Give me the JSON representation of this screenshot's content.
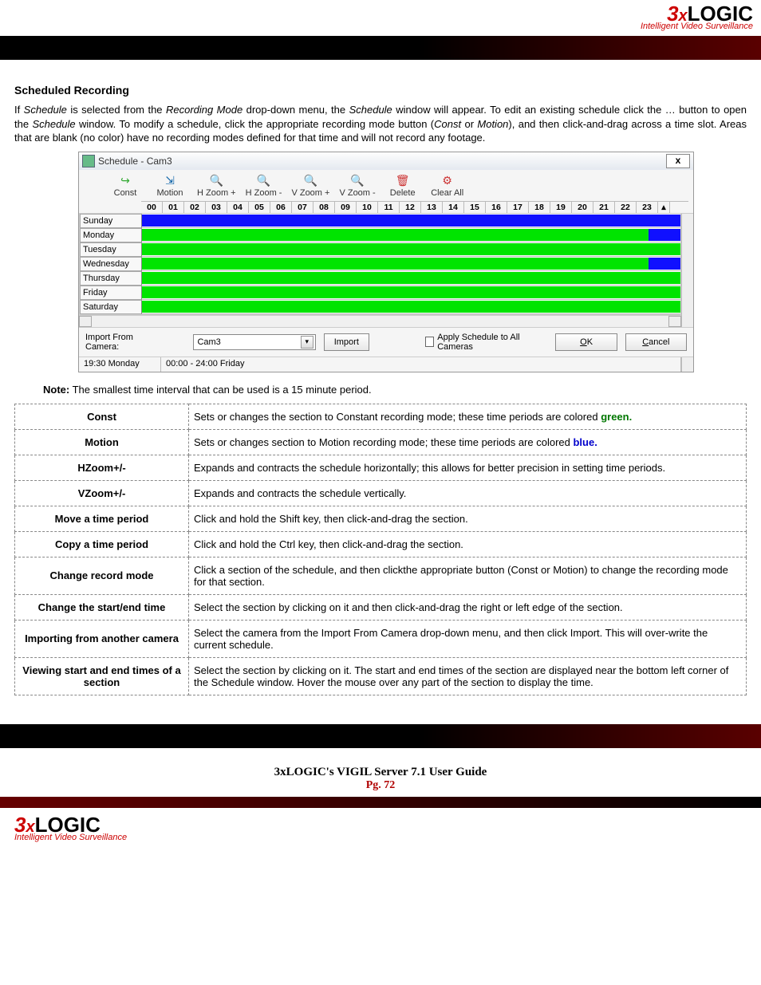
{
  "brand": {
    "three": "3",
    "x": "x",
    "name": "LOGIC",
    "tagline": "Intelligent Video Surveillance"
  },
  "heading": "Scheduled Recording",
  "para": "If Schedule is selected from the Recording Mode drop-down menu, the Schedule window will appear. To edit an existing schedule click the … button to open the Schedule window. To modify a schedule, click the appropriate recording mode button (Const or Motion), and then click-and-drag across a time slot. Areas that are blank (no color) have no recording modes defined for that time and will not record any footage.",
  "window": {
    "title": "Schedule - Cam3",
    "tools": [
      "Const",
      "Motion",
      "H Zoom +",
      "H Zoom -",
      "V Zoom +",
      "V Zoom -",
      "Delete",
      "Clear All"
    ],
    "hours": [
      "00",
      "01",
      "02",
      "03",
      "04",
      "05",
      "06",
      "07",
      "08",
      "09",
      "10",
      "11",
      "12",
      "13",
      "14",
      "15",
      "16",
      "17",
      "18",
      "19",
      "20",
      "21",
      "22",
      "23"
    ],
    "days": [
      "Sunday",
      "Monday",
      "Tuesday",
      "Wednesday",
      "Thursday",
      "Friday",
      "Saturday"
    ],
    "importLabel": "Import From Camera:",
    "importValue": "Cam3",
    "importBtn": "Import",
    "applyAll": "Apply Schedule to All Cameras",
    "ok": "OK",
    "cancel": "Cancel",
    "status1": "19:30  Monday",
    "status2": "00:00 - 24:00  Friday"
  },
  "noteLabel": "Note:",
  "noteText": " The smallest time interval that can be used is a 15 minute period.",
  "defs": [
    {
      "k": "Const",
      "v": "Sets or changes the section to Constant recording mode; these time periods are colored ",
      "suffix": "green.",
      "cls": "green"
    },
    {
      "k": "Motion",
      "v": "Sets or changes section to Motion recording mode; these time periods are colored ",
      "suffix": "blue.",
      "cls": "blue"
    },
    {
      "k": "HZoom+/-",
      "v": "Expands and contracts the schedule horizontally; this allows for better precision in setting time periods."
    },
    {
      "k": "VZoom+/-",
      "v": "Expands and contracts the schedule vertically."
    },
    {
      "k": "Move a time period",
      "v": "Click and hold the Shift key, then click-and-drag the section."
    },
    {
      "k": "Copy a time period",
      "v": "Click and hold the Ctrl key, then click-and-drag the section."
    },
    {
      "k": "Change record mode",
      "v": "Click a section of the schedule, and then clickthe appropriate button (Const or Motion) to change the recording mode for that section."
    },
    {
      "k": "Change the start/end time",
      "v": "Select the section by clicking on it and then click-and-drag the right or left edge of the section."
    },
    {
      "k": "Importing from another camera",
      "v": "Select the camera from the Import From Camera drop-down menu, and then click Import.  This will over-write the current schedule."
    },
    {
      "k": "Viewing start and end times of a section",
      "v": "Select the section by clicking on it. The start and end times of the section are displayed near the bottom left corner of the Schedule window.  Hover the mouse over any part of the section to display the time."
    }
  ],
  "footer": {
    "title": "3xLOGIC's VIGIL Server 7.1 User Guide",
    "page": "Pg. 72"
  }
}
